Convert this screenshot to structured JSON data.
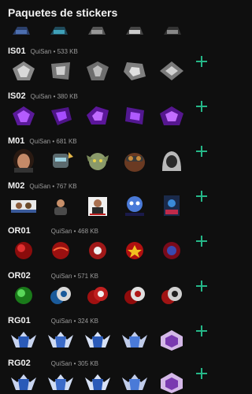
{
  "header": {
    "title": "Paquetes de stickers"
  },
  "packs": [
    {
      "name": "IS01",
      "author": "QuiSan",
      "size": "533 KB"
    },
    {
      "name": "IS02",
      "author": "QuiSan",
      "size": "380 KB"
    },
    {
      "name": "M01",
      "author": "QuiSan",
      "size": "681 KB"
    },
    {
      "name": "M02",
      "author": "QuiSan",
      "size": "767 KB"
    },
    {
      "name": "OR01",
      "author": "QuiSan",
      "size": "468 KB"
    },
    {
      "name": "OR02",
      "author": "QuiSan",
      "size": "571 KB"
    },
    {
      "name": "RG01",
      "author": "QuiSan",
      "size": "324 KB"
    },
    {
      "name": "RG02",
      "author": "QuiSan",
      "size": "305 KB"
    }
  ],
  "separator": "•",
  "colors": {
    "accent": "#25b788",
    "background": "#0f0f0f",
    "meta": "#9a9a9a"
  },
  "icons": {
    "add": "plus-icon"
  }
}
